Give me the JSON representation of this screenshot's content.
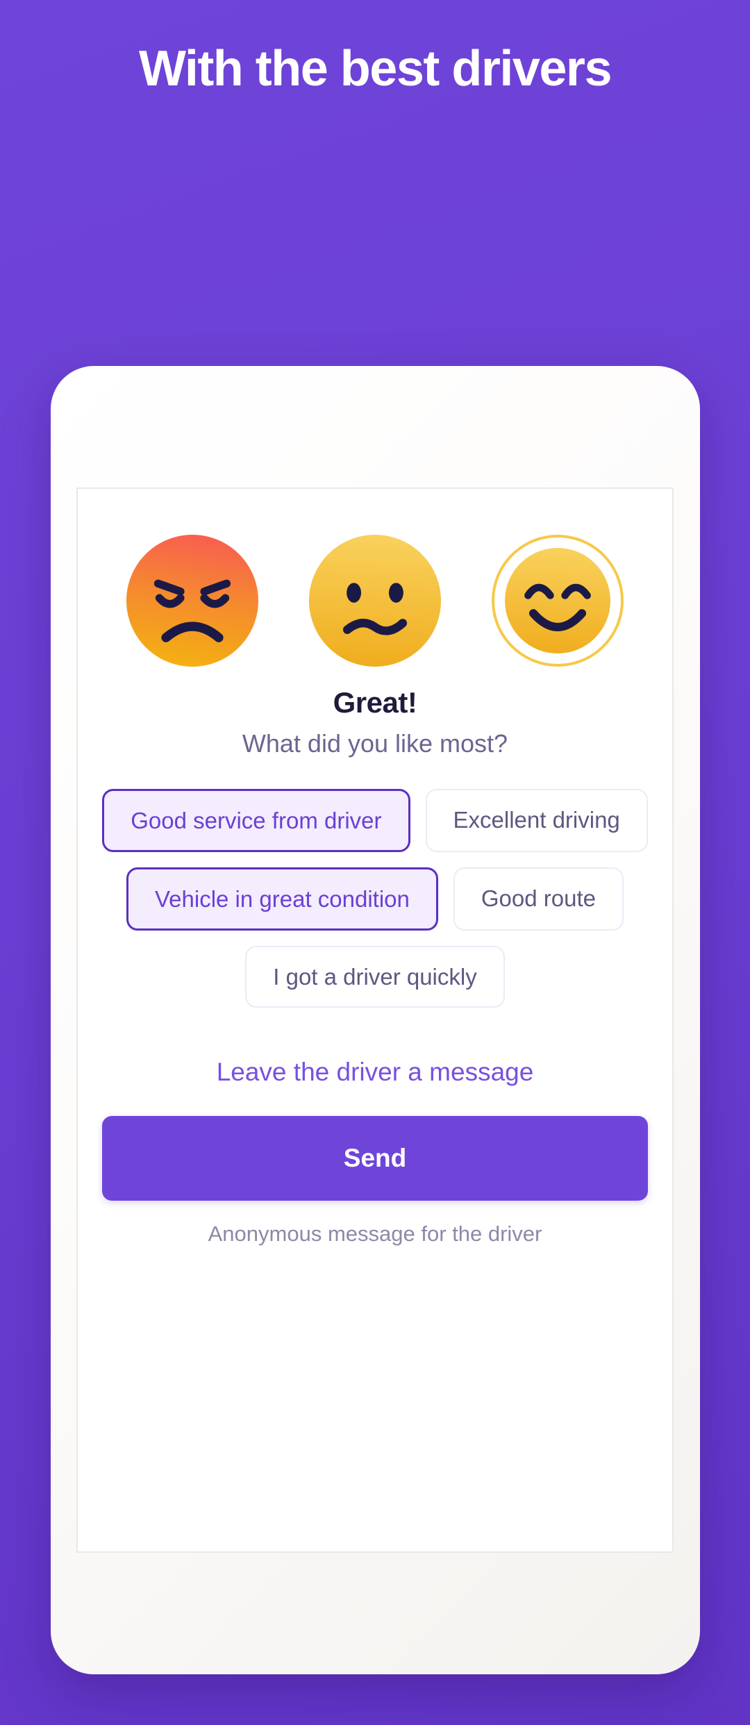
{
  "page": {
    "headline": "With the best drivers",
    "background_color": "#6B3FD4"
  },
  "screen": {
    "rating": {
      "options": [
        {
          "name": "angry-face-icon",
          "label": "Angry",
          "selected": false,
          "color_start": "#F8604F",
          "color_end": "#F5A623"
        },
        {
          "name": "neutral-face-icon",
          "label": "Neutral",
          "selected": false,
          "color_start": "#F8CC52",
          "color_end": "#F2B127"
        },
        {
          "name": "happy-face-icon",
          "label": "Happy",
          "selected": true,
          "color_start": "#F8CC52",
          "color_end": "#F2B127"
        }
      ],
      "selected_ring_color": "#F7C948"
    },
    "title": "Great!",
    "subtitle": "What did you like most?",
    "chips": [
      {
        "label": "Good service from driver",
        "selected": true
      },
      {
        "label": "Excellent driving",
        "selected": false
      },
      {
        "label": "Vehicle in great condition",
        "selected": true
      },
      {
        "label": "Good route",
        "selected": false
      },
      {
        "label": "I got a driver quickly",
        "selected": false
      }
    ],
    "message_link": "Leave the driver a message",
    "send_label": "Send",
    "send_color": "#6F45D9",
    "footer_note": "Anonymous message for the driver"
  }
}
